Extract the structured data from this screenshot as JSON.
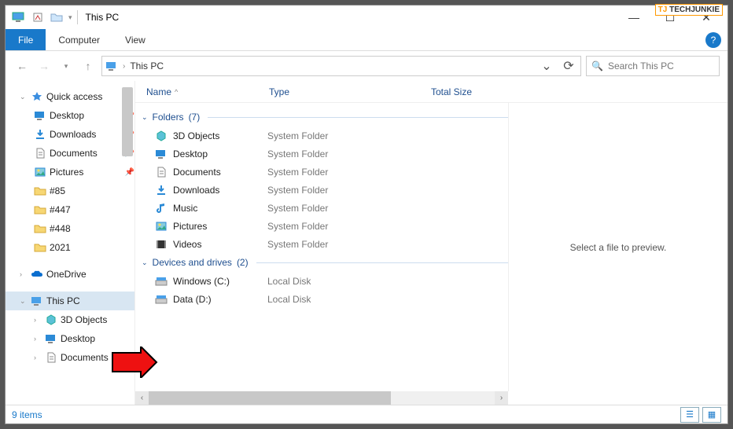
{
  "watermark": "TECHJUNKIE",
  "window": {
    "title": "This PC",
    "minimize": "—",
    "maximize": "☐",
    "close": "✕"
  },
  "ribbon": {
    "file": "File",
    "tabs": [
      "Computer",
      "View"
    ],
    "help": "?"
  },
  "address": {
    "crumb": "This PC",
    "chev": "›",
    "search_placeholder": "Search This PC"
  },
  "nav": {
    "quick_access": "Quick access",
    "items_pinned": [
      {
        "label": "Desktop",
        "icon": "desktop"
      },
      {
        "label": "Downloads",
        "icon": "downloads"
      },
      {
        "label": "Documents",
        "icon": "documents"
      },
      {
        "label": "Pictures",
        "icon": "pictures"
      }
    ],
    "items_recent": [
      {
        "label": "#85"
      },
      {
        "label": "#447"
      },
      {
        "label": "#448"
      },
      {
        "label": "2021"
      }
    ],
    "onedrive": "OneDrive",
    "this_pc": "This PC",
    "this_pc_children": [
      {
        "label": "3D Objects",
        "icon": "3d"
      },
      {
        "label": "Desktop",
        "icon": "desktop"
      },
      {
        "label": "Documents",
        "icon": "documents"
      }
    ]
  },
  "columns": {
    "name": "Name",
    "type": "Type",
    "total_size": "Total Size"
  },
  "groups": {
    "folders": {
      "label": "Folders",
      "count": "(7)"
    },
    "drives": {
      "label": "Devices and drives",
      "count": "(2)"
    }
  },
  "folders": [
    {
      "name": "3D Objects",
      "type": "System Folder",
      "icon": "3d"
    },
    {
      "name": "Desktop",
      "type": "System Folder",
      "icon": "desktop"
    },
    {
      "name": "Documents",
      "type": "System Folder",
      "icon": "documents"
    },
    {
      "name": "Downloads",
      "type": "System Folder",
      "icon": "downloads"
    },
    {
      "name": "Music",
      "type": "System Folder",
      "icon": "music"
    },
    {
      "name": "Pictures",
      "type": "System Folder",
      "icon": "pictures"
    },
    {
      "name": "Videos",
      "type": "System Folder",
      "icon": "videos"
    }
  ],
  "drives": [
    {
      "name": "Windows (C:)",
      "type": "Local Disk",
      "icon": "drive"
    },
    {
      "name": "Data (D:)",
      "type": "Local Disk",
      "icon": "drive"
    }
  ],
  "preview_empty": "Select a file to preview.",
  "status": {
    "count": "9 items"
  }
}
